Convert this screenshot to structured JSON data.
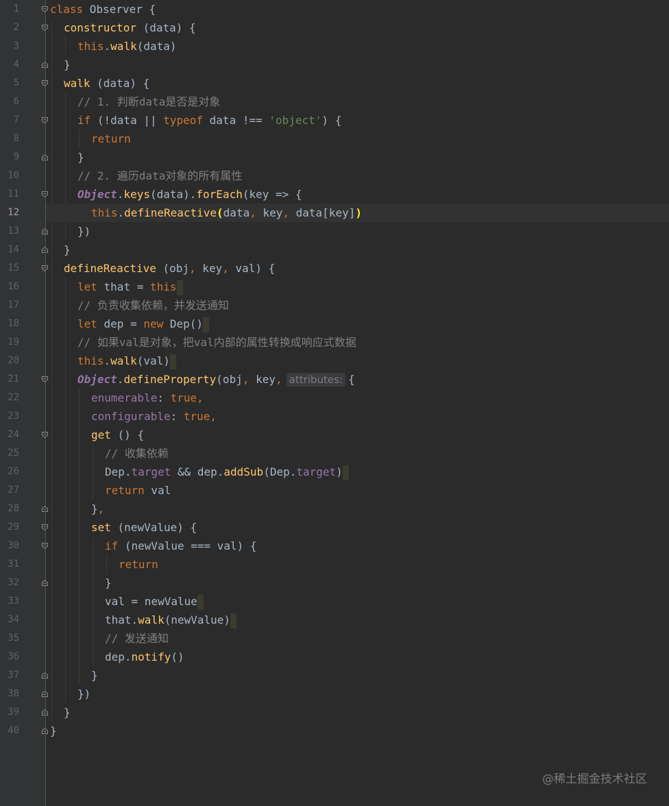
{
  "editor": {
    "current_line": 12,
    "colors": {
      "background": "#2b2b2b",
      "gutter": "#313335",
      "keyword": "#cc7832",
      "function": "#ffc66d",
      "string": "#6a8759",
      "comment": "#808080",
      "property": "#9876aa",
      "text": "#a9b7c6"
    },
    "fold_icon": "fold-marker-icon",
    "lines": [
      {
        "n": "1",
        "indent": 0,
        "fold": "open",
        "tokens": [
          [
            "kw",
            "class"
          ],
          [
            "p",
            " Observer {"
          ]
        ]
      },
      {
        "n": "2",
        "indent": 1,
        "fold": "open",
        "tokens": [
          [
            "fn",
            "constructor"
          ],
          [
            "p",
            " (data) {"
          ]
        ]
      },
      {
        "n": "3",
        "indent": 2,
        "tokens": [
          [
            "kw",
            "this"
          ],
          [
            "p",
            "."
          ],
          [
            "fn",
            "walk"
          ],
          [
            "p",
            "(data)"
          ]
        ]
      },
      {
        "n": "4",
        "indent": 1,
        "fold": "close",
        "tokens": [
          [
            "p",
            "}"
          ]
        ]
      },
      {
        "n": "5",
        "indent": 1,
        "fold": "open",
        "tokens": [
          [
            "fn",
            "walk"
          ],
          [
            "p",
            " (data) {"
          ]
        ]
      },
      {
        "n": "6",
        "indent": 2,
        "tokens": [
          [
            "cmt",
            "// 1. 判断data是否是对象"
          ]
        ]
      },
      {
        "n": "7",
        "indent": 2,
        "fold": "open",
        "tokens": [
          [
            "kw",
            "if"
          ],
          [
            "p",
            " (!data || "
          ],
          [
            "kw",
            "typeof"
          ],
          [
            "p",
            " data !== "
          ],
          [
            "str",
            "'object'"
          ],
          [
            "p",
            ") {"
          ]
        ]
      },
      {
        "n": "8",
        "indent": 3,
        "tokens": [
          [
            "kw",
            "return"
          ]
        ]
      },
      {
        "n": "9",
        "indent": 2,
        "fold": "close",
        "tokens": [
          [
            "p",
            "}"
          ]
        ]
      },
      {
        "n": "10",
        "indent": 2,
        "tokens": [
          [
            "cmt",
            "// 2. 遍历data对象的所有属性"
          ]
        ]
      },
      {
        "n": "11",
        "indent": 2,
        "fold": "open",
        "tokens": [
          [
            "cls",
            "Object"
          ],
          [
            "p",
            "."
          ],
          [
            "fn",
            "keys"
          ],
          [
            "p",
            "(data)."
          ],
          [
            "fn",
            "forEach"
          ],
          [
            "p",
            "(key => {"
          ]
        ]
      },
      {
        "n": "12",
        "indent": 3,
        "tokens": [
          [
            "kw",
            "this"
          ],
          [
            "p",
            "."
          ],
          [
            "fn",
            "defineReactive"
          ],
          [
            "bm",
            "("
          ],
          [
            "p",
            "data"
          ],
          [
            "kw",
            ","
          ],
          [
            "p",
            " key"
          ],
          [
            "kw",
            ","
          ],
          [
            "p",
            " data[key]"
          ],
          [
            "bm",
            ")"
          ]
        ]
      },
      {
        "n": "13",
        "indent": 2,
        "fold": "close",
        "tokens": [
          [
            "p",
            "})"
          ]
        ]
      },
      {
        "n": "14",
        "indent": 1,
        "fold": "close",
        "tokens": [
          [
            "p",
            "}"
          ]
        ]
      },
      {
        "n": "15",
        "indent": 1,
        "fold": "open",
        "tokens": [
          [
            "fn",
            "defineReactive"
          ],
          [
            "p",
            " (obj"
          ],
          [
            "kw",
            ","
          ],
          [
            "p",
            " key"
          ],
          [
            "kw",
            ","
          ],
          [
            "p",
            " val) {"
          ]
        ]
      },
      {
        "n": "16",
        "indent": 2,
        "caret": true,
        "tokens": [
          [
            "kw",
            "let"
          ],
          [
            "p",
            " that = "
          ],
          [
            "kw",
            "this"
          ]
        ]
      },
      {
        "n": "17",
        "indent": 2,
        "tokens": [
          [
            "cmt",
            "// 负责收集依赖，并发送通知"
          ]
        ]
      },
      {
        "n": "18",
        "indent": 2,
        "caret": true,
        "tokens": [
          [
            "kw",
            "let"
          ],
          [
            "p",
            " dep = "
          ],
          [
            "kw",
            "new"
          ],
          [
            "p",
            " Dep()"
          ]
        ]
      },
      {
        "n": "19",
        "indent": 2,
        "tokens": [
          [
            "cmt",
            "// 如果val是对象，把val内部的属性转换成响应式数据"
          ]
        ]
      },
      {
        "n": "20",
        "indent": 2,
        "caret": true,
        "tokens": [
          [
            "kw",
            "this"
          ],
          [
            "p",
            "."
          ],
          [
            "fn",
            "walk"
          ],
          [
            "p",
            "(val)"
          ]
        ]
      },
      {
        "n": "21",
        "indent": 2,
        "fold": "open",
        "tokens": [
          [
            "cls",
            "Object"
          ],
          [
            "p",
            "."
          ],
          [
            "fn",
            "defineProperty"
          ],
          [
            "p",
            "(obj"
          ],
          [
            "kw",
            ","
          ],
          [
            "p",
            " key"
          ],
          [
            "kw",
            ","
          ],
          [
            "hint",
            "attributes:"
          ],
          [
            "p",
            "{"
          ]
        ]
      },
      {
        "n": "22",
        "indent": 3,
        "tokens": [
          [
            "prop",
            "enumerable"
          ],
          [
            "p",
            ": "
          ],
          [
            "kw",
            "true,"
          ]
        ]
      },
      {
        "n": "23",
        "indent": 3,
        "tokens": [
          [
            "prop",
            "configurable"
          ],
          [
            "p",
            ": "
          ],
          [
            "kw",
            "true,"
          ]
        ]
      },
      {
        "n": "24",
        "indent": 3,
        "fold": "open",
        "tokens": [
          [
            "fn",
            "get"
          ],
          [
            "p",
            " () {"
          ]
        ]
      },
      {
        "n": "25",
        "indent": 4,
        "tokens": [
          [
            "cmt",
            "// 收集依赖"
          ]
        ]
      },
      {
        "n": "26",
        "indent": 4,
        "caret": true,
        "tokens": [
          [
            "p",
            "Dep."
          ],
          [
            "prop",
            "target"
          ],
          [
            "p",
            " && dep."
          ],
          [
            "fn",
            "addSub"
          ],
          [
            "p",
            "(Dep."
          ],
          [
            "prop",
            "target"
          ],
          [
            "p",
            ")"
          ]
        ]
      },
      {
        "n": "27",
        "indent": 4,
        "tokens": [
          [
            "kw",
            "return"
          ],
          [
            "p",
            " val"
          ]
        ]
      },
      {
        "n": "28",
        "indent": 3,
        "fold": "close",
        "tokens": [
          [
            "p",
            "}"
          ],
          [
            "kw",
            ","
          ]
        ]
      },
      {
        "n": "29",
        "indent": 3,
        "fold": "open",
        "tokens": [
          [
            "fn",
            "set"
          ],
          [
            "p",
            " (newValue) {"
          ]
        ]
      },
      {
        "n": "30",
        "indent": 4,
        "fold": "open",
        "tokens": [
          [
            "kw",
            "if"
          ],
          [
            "p",
            " (newValue === val) {"
          ]
        ]
      },
      {
        "n": "31",
        "indent": 5,
        "tokens": [
          [
            "kw",
            "return"
          ]
        ]
      },
      {
        "n": "32",
        "indent": 4,
        "fold": "close",
        "tokens": [
          [
            "p",
            "}"
          ]
        ]
      },
      {
        "n": "33",
        "indent": 4,
        "caret": true,
        "tokens": [
          [
            "p",
            "val = newValue"
          ]
        ]
      },
      {
        "n": "34",
        "indent": 4,
        "caret": true,
        "tokens": [
          [
            "p",
            "that."
          ],
          [
            "fn",
            "walk"
          ],
          [
            "p",
            "(newValue)"
          ]
        ]
      },
      {
        "n": "35",
        "indent": 4,
        "tokens": [
          [
            "cmt",
            "// 发送通知"
          ]
        ]
      },
      {
        "n": "36",
        "indent": 4,
        "tokens": [
          [
            "p",
            "dep."
          ],
          [
            "fn",
            "notify"
          ],
          [
            "p",
            "()"
          ]
        ]
      },
      {
        "n": "37",
        "indent": 3,
        "fold": "close",
        "tokens": [
          [
            "p",
            "}"
          ]
        ]
      },
      {
        "n": "38",
        "indent": 2,
        "fold": "close",
        "tokens": [
          [
            "p",
            "})"
          ]
        ]
      },
      {
        "n": "39",
        "indent": 1,
        "fold": "close",
        "tokens": [
          [
            "p",
            "}"
          ]
        ]
      },
      {
        "n": "40",
        "indent": 0,
        "fold": "close",
        "tokens": [
          [
            "p",
            "}"
          ]
        ]
      }
    ]
  },
  "watermark": "@稀土掘金技术社区"
}
